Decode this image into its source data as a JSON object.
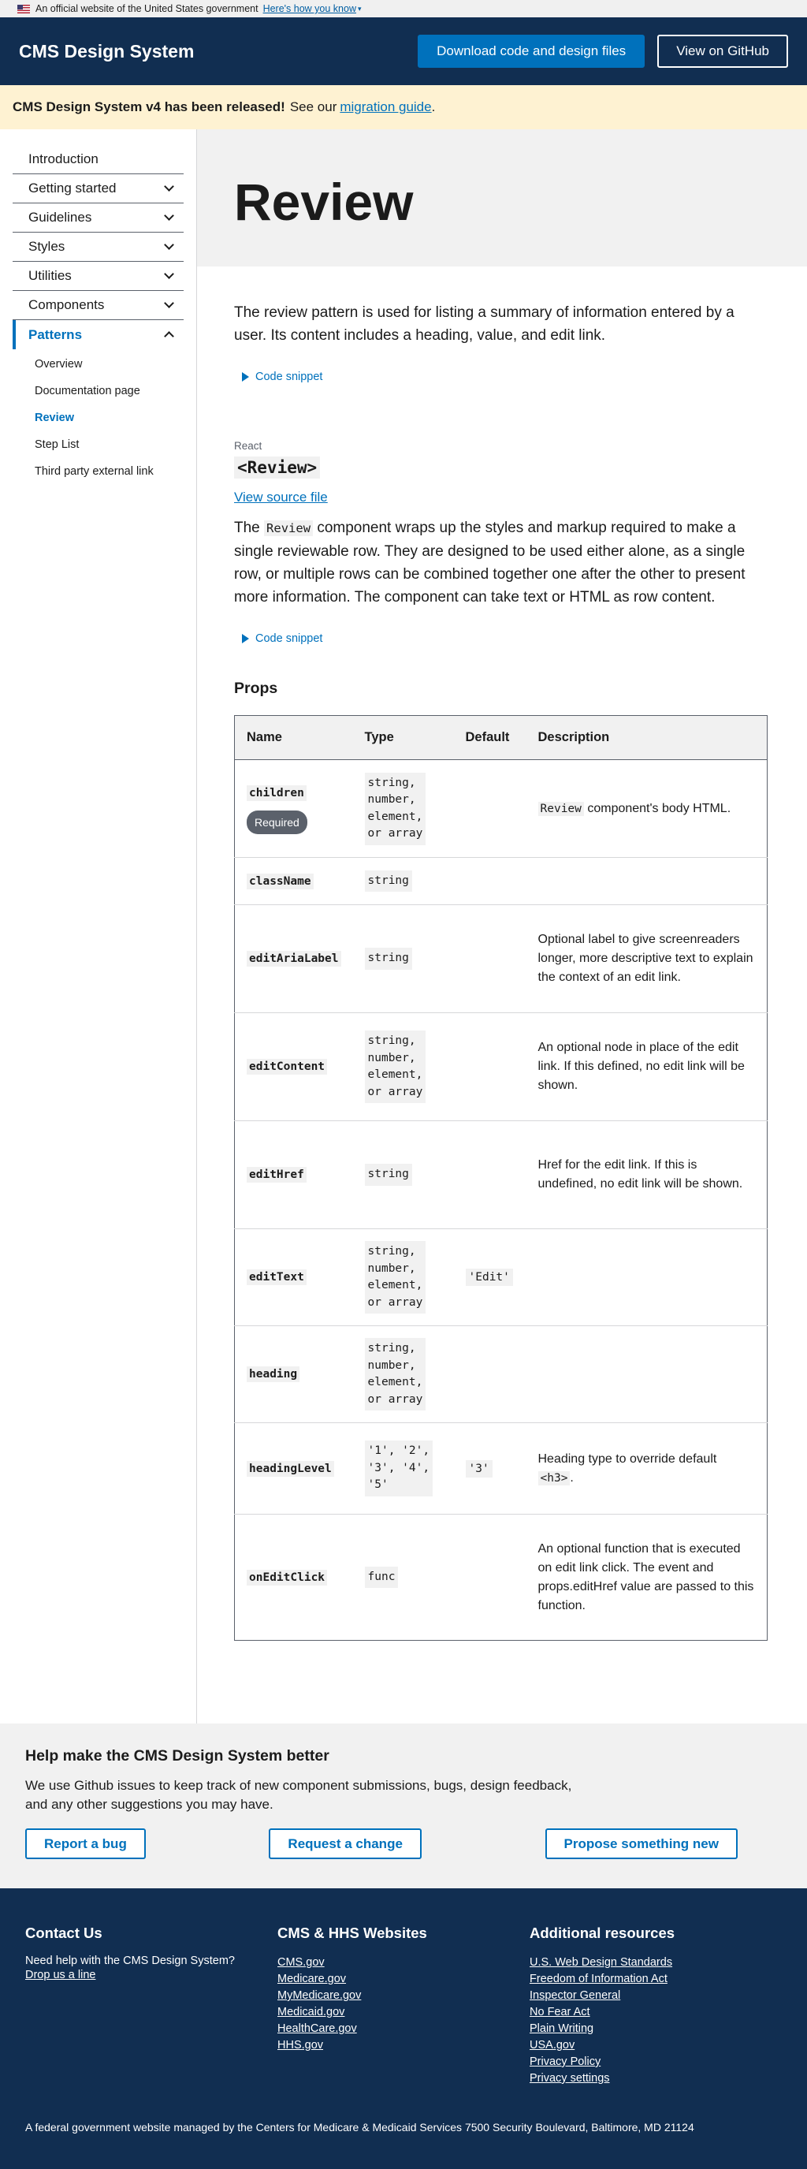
{
  "banner": {
    "text": "An official website of the United States government",
    "link": "Here's how you know"
  },
  "header": {
    "title": "CMS Design System",
    "download": "Download code and design files",
    "github": "View on GitHub"
  },
  "alert": {
    "strong": "CMS Design System v4 has been released!",
    "text": "See our",
    "link": "migration guide",
    "end": "."
  },
  "sidebar": {
    "items": [
      {
        "label": "Introduction"
      },
      {
        "label": "Getting started"
      },
      {
        "label": "Guidelines"
      },
      {
        "label": "Styles"
      },
      {
        "label": "Utilities"
      },
      {
        "label": "Components"
      },
      {
        "label": "Patterns"
      }
    ],
    "sub": [
      "Overview",
      "Documentation page",
      "Review",
      "Step List",
      "Third party external link"
    ]
  },
  "page": {
    "title": "Review",
    "lead": "The review pattern is used for listing a summary of information entered by a user. Its content includes a heading, value, and edit link.",
    "snippet1": "Code snippet",
    "react": "React",
    "component": "<Review>",
    "source": "View source file",
    "desc_pre": "The",
    "desc_code": "Review",
    "desc_post": "component wraps up the styles and markup required to make a single reviewable row. They are designed to be used either alone, as a single row, or multiple rows can be combined together one after the other to present more information. The component can take text or HTML as row content.",
    "snippet2": "Code snippet",
    "props": "Props"
  },
  "table": {
    "headers": [
      "Name",
      "Type",
      "Default",
      "Description"
    ],
    "required": "Required",
    "rows": [
      {
        "name": "children",
        "type": "string,\nnumber,\nelement,\nor array",
        "default": "",
        "desc_code": "Review",
        "desc": " component's body HTML."
      },
      {
        "name": "className",
        "type": "string",
        "default": "",
        "desc": ""
      },
      {
        "name": "editAriaLabel",
        "type": "string",
        "default": "",
        "desc": "Optional label to give screenreaders longer, more descriptive text to explain the context of an edit link."
      },
      {
        "name": "editContent",
        "type": "string,\nnumber,\nelement,\nor array",
        "default": "",
        "desc": "An optional node in place of the edit link. If this defined, no edit link will be shown."
      },
      {
        "name": "editHref",
        "type": "string",
        "default": "",
        "desc": "Href for the edit link. If this is undefined, no edit link will be shown."
      },
      {
        "name": "editText",
        "type": "string,\nnumber,\nelement,\nor array",
        "default": "'Edit'",
        "desc": ""
      },
      {
        "name": "heading",
        "type": "string,\nnumber,\nelement,\nor array",
        "default": "",
        "desc": ""
      },
      {
        "name": "headingLevel",
        "type": "'1', '2',\n'3', '4',\n'5'",
        "default": "'3'",
        "desc": "Heading type to override default ",
        "desc_code_after": "<h3>",
        "desc_end": "."
      },
      {
        "name": "onEditClick",
        "type": "func",
        "default": "",
        "desc": "An optional function that is executed on edit link click. The event and props.editHref value are passed to this function."
      }
    ]
  },
  "help": {
    "title": "Help make the CMS Design System better",
    "text": "We use Github issues to keep track of new component submissions, bugs, design feedback, and any other suggestions you may have.",
    "buttons": [
      "Report a bug",
      "Request a change",
      "Propose something new"
    ]
  },
  "footer": {
    "contact_title": "Contact Us",
    "contact_text": "Need help with the CMS Design System?",
    "contact_link": "Drop us a line",
    "sites_title": "CMS & HHS Websites",
    "sites": [
      "CMS.gov",
      "Medicare.gov",
      "MyMedicare.gov",
      "Medicaid.gov",
      "HealthCare.gov",
      "HHS.gov"
    ],
    "res_title": "Additional resources",
    "resources": [
      "U.S. Web Design Standards",
      "Freedom of Information Act",
      "Inspector General",
      "No Fear Act",
      "Plain Writing",
      "USA.gov",
      "Privacy Policy",
      "Privacy settings"
    ],
    "bottom": "A federal government website managed by the Centers for Medicare & Medicaid Services 7500 Security Boulevard, Baltimore, MD 21124"
  }
}
